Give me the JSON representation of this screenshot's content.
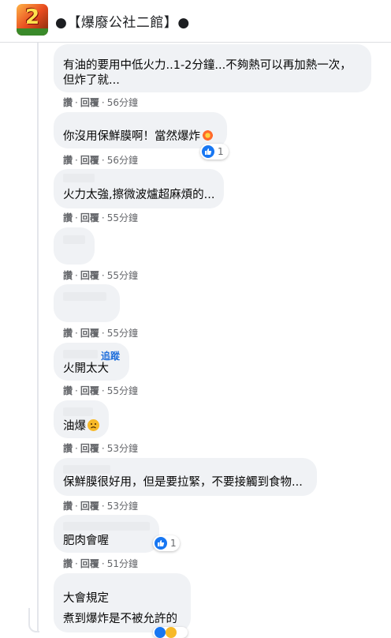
{
  "header": {
    "logo_text": "2",
    "group_title": "●【爆廢公社二館】●"
  },
  "actions": {
    "like": "讚",
    "reply": "回覆",
    "dot": "·"
  },
  "comments": [
    {
      "lines": [
        "有油的要用中低火力..1-2分鐘...不夠熱可以再加熱一次，",
        "但炸了就..."
      ],
      "time": "56分鐘"
    },
    {
      "lines": [
        "你沒用保鮮膜啊！當然爆炸"
      ],
      "emoji": "collision-emoji",
      "time": "56分鐘",
      "reactions": "1"
    },
    {
      "lines": [
        "火力太強,擦微波爐超麻煩的..."
      ],
      "time": "55分鐘"
    },
    {
      "lines": [
        ""
      ],
      "time": "55分鐘"
    },
    {
      "lines": [
        ""
      ],
      "time": "55分鐘"
    },
    {
      "lines": [
        "火開太大"
      ],
      "follow": "追蹤",
      "time": "55分鐘"
    },
    {
      "lines": [
        "油爆"
      ],
      "emoji": "sad-face-emoji",
      "time": "53分鐘"
    },
    {
      "lines": [
        "保鮮膜很好用，但是要拉緊，不要接觸到食物..."
      ],
      "time": "53分鐘"
    },
    {
      "lines": [
        "肥肉會喔"
      ],
      "time": "51分鐘",
      "reactions": "1"
    },
    {
      "lines": [
        "大會規定",
        "煮到爆炸是不被允許的"
      ]
    }
  ],
  "colors": {
    "bubble": "#f0f2f5",
    "link_blue": "#216fdb",
    "like_blue": "#1877f2",
    "meta_gray": "#65676b"
  }
}
